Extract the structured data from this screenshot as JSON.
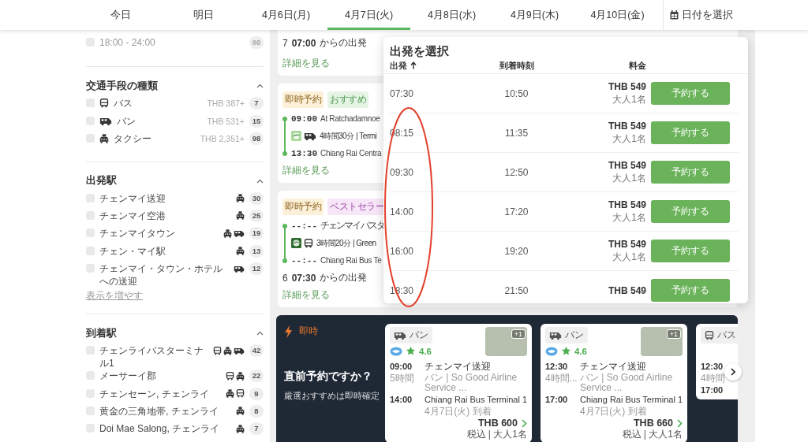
{
  "date_tabs": [
    {
      "label": "今日",
      "selected": false
    },
    {
      "label": "明日",
      "selected": false
    },
    {
      "label": "4月6日(月)",
      "selected": false
    },
    {
      "label": "4月7日(火)",
      "selected": true
    },
    {
      "label": "4月8日(水)",
      "selected": false
    },
    {
      "label": "4月9日(木)",
      "selected": false
    },
    {
      "label": "4月10日(金)",
      "selected": false
    }
  ],
  "date_picker": {
    "label": "日付を選択"
  },
  "filters": [
    {
      "items": [
        {
          "label": "18:00 - 24:00",
          "count": "98",
          "checked": false,
          "disabled": true
        }
      ]
    },
    {
      "title": "交通手段の種類",
      "expanded": true,
      "items": [
        {
          "label": "バス",
          "icons": [
            {
              "kind": "bus"
            }
          ],
          "price": "THB 387+",
          "count": "7",
          "checked": false,
          "disabled": false,
          "icon_before": true
        },
        {
          "label": "バン",
          "icons": [
            {
              "kind": "van"
            }
          ],
          "price": "THB 531+",
          "count": "15",
          "checked": false,
          "disabled": false,
          "icon_before": true
        },
        {
          "label": "タクシー",
          "icons": [
            {
              "kind": "taxi"
            }
          ],
          "price": "THB 2,351+",
          "count": "98",
          "checked": false,
          "disabled": false,
          "icon_before": true
        }
      ]
    },
    {
      "title": "出発駅",
      "expanded": true,
      "show_more": "表示を増やす",
      "items": [
        {
          "label": "チェンマイ送迎",
          "icons": [
            {
              "kind": "taxi"
            }
          ],
          "count": "30",
          "checked": false,
          "disabled": false
        },
        {
          "label": "チェンマイ空港",
          "icons": [
            {
              "kind": "taxi"
            }
          ],
          "count": "25",
          "checked": false,
          "disabled": false
        },
        {
          "label": "チェンマイタウン",
          "icons": [
            {
              "kind": "taxi"
            },
            {
              "kind": "van"
            }
          ],
          "count": "19",
          "checked": false,
          "disabled": false
        },
        {
          "label": "チェン・マイ駅",
          "icons": [
            {
              "kind": "taxi"
            }
          ],
          "count": "13",
          "checked": false,
          "disabled": false
        },
        {
          "label": "チェンマイ・タウン・ホテルへの送迎",
          "icons": [
            {
              "kind": "van"
            }
          ],
          "count": "12",
          "checked": false,
          "disabled": false
        }
      ]
    },
    {
      "title": "到着駅",
      "expanded": true,
      "items": [
        {
          "label": "チェンライバスターミナル1",
          "icons": [
            {
              "kind": "bus"
            },
            {
              "kind": "taxi"
            },
            {
              "kind": "van"
            }
          ],
          "count": "42",
          "checked": false,
          "disabled": false
        },
        {
          "label": "メーサーイ郡",
          "icons": [
            {
              "kind": "bus"
            },
            {
              "kind": "taxi"
            }
          ],
          "count": "22",
          "checked": false,
          "disabled": false
        },
        {
          "label": "チェンセーン, チェンライ",
          "icons": [
            {
              "kind": "taxi"
            },
            {
              "kind": "bus"
            }
          ],
          "count": "9",
          "checked": false,
          "disabled": false
        },
        {
          "label": "黄金の三角地帯, チェンライ",
          "icons": [
            {
              "kind": "taxi"
            }
          ],
          "count": "8",
          "checked": false,
          "disabled": false
        },
        {
          "label": "Doi Mae Salong, チェンライ",
          "icons": [
            {
              "kind": "taxi"
            }
          ],
          "count": "7",
          "checked": false,
          "disabled": false
        }
      ]
    }
  ],
  "results": [
    {
      "departures": {
        "count": "7",
        "time": "07:00",
        "text": "からの出発"
      },
      "link": "詳細を見る"
    },
    {
      "badges": [
        {
          "label": "即時予約",
          "kind": "instant"
        },
        {
          "label": "おすすめ",
          "kind": "recommended"
        }
      ],
      "stops": [
        {
          "time": "09:00",
          "place": "At Ratchadamnoe"
        },
        {
          "time": "13:30",
          "place": "Chiang Rai Centra"
        }
      ],
      "vehicle": {
        "kind": "van"
      },
      "duration": "4時間30分 | Termi",
      "link": "詳細を見る"
    },
    {
      "badges": [
        {
          "label": "即時予約",
          "kind": "instant"
        },
        {
          "label": "ベストセラー",
          "kind": "bestseller"
        }
      ],
      "stops": [
        {
          "time": "--:--",
          "place": "チェンマイバスタ"
        },
        {
          "time": "--:--",
          "place": "Chiang Rai Bus Te"
        }
      ],
      "vehicle": {
        "kind": "bus"
      },
      "duration": "3時間20分 | Green",
      "departures": {
        "count": "6",
        "time": "07:30",
        "text": "からの出発"
      },
      "link": "詳細を見る"
    }
  ],
  "departure_popup": {
    "title": "出発を選択",
    "columns": [
      {
        "label": "出発",
        "sorted": true
      },
      {
        "label": "到着時刻"
      },
      {
        "label": "料金"
      }
    ],
    "rows": [
      {
        "departure": "07:30",
        "arrival": "10:50",
        "price": "THB 549",
        "passengers": "大人1名",
        "button": "予約する"
      },
      {
        "departure": "08:15",
        "arrival": "11:35",
        "price": "THB 549",
        "passengers": "大人1名",
        "button": "予約する"
      },
      {
        "departure": "09:30",
        "arrival": "12:50",
        "price": "THB 549",
        "passengers": "大人1名",
        "button": "予約する"
      },
      {
        "departure": "14:00",
        "arrival": "17:20",
        "price": "THB 549",
        "passengers": "大人1名",
        "button": "予約する"
      },
      {
        "departure": "16:00",
        "arrival": "19:20",
        "price": "THB 549",
        "passengers": "大人1名",
        "button": "予約する"
      },
      {
        "departure": "18:30",
        "arrival": "21:50",
        "price": "THB 549",
        "button": "予約する"
      }
    ]
  },
  "instant": {
    "label": "即時",
    "heading": "直前予約ですか？",
    "subtitle": "厳選おすすめは即時確定",
    "cards": [
      {
        "vehicle": {
          "kind": "van"
        },
        "vehicle_label": "バン",
        "photo_extra": "+1",
        "rating": "4.6",
        "departure_time": "09:00",
        "departure_place": "チェンマイ送迎",
        "duration": "5時間",
        "operator": "バン | So Good Airline Service ...",
        "arrival_time": "14:00",
        "arrival_place": "Chiang Rai Bus Terminal 1",
        "arrival_date": "4月7日(火) 到着",
        "price": "THB 600",
        "price_note": "税込 | 大人1名"
      },
      {
        "vehicle": {
          "kind": "van"
        },
        "vehicle_label": "バン",
        "photo_extra": "+1",
        "rating": "4.6",
        "departure_time": "12:30",
        "departure_place": "チェンマイ送迎",
        "duration": "4時間...",
        "operator": "バン | So Good Airline Service ...",
        "arrival_time": "17:00",
        "arrival_place": "Chiang Rai Bus Terminal 1",
        "arrival_date": "4月7日(火) 到着",
        "price": "THB 660",
        "price_note": "税込 | 大人1名"
      },
      {
        "vehicle": {
          "kind": "bus"
        },
        "vehicle_label": "バス",
        "departure_time": "12:30",
        "duration": "4時間",
        "arrival_time": "17:00"
      }
    ]
  }
}
